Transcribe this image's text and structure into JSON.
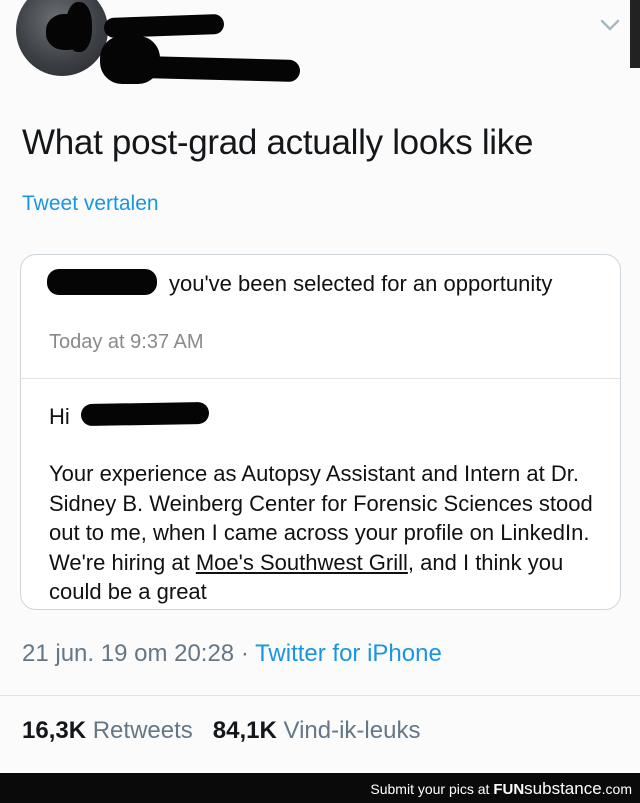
{
  "tweet": {
    "text": "What post-grad actually looks like",
    "translate_label": "Tweet vertalen",
    "timestamp": "21 jun. 19 om 20:28",
    "separator": "·",
    "source": "Twitter for iPhone",
    "retweets_count": "16,3K",
    "retweets_label": "Retweets",
    "likes_count": "84,1K",
    "likes_label": "Vind-ik-leuks"
  },
  "email": {
    "subject": "you've been selected for an opportunity",
    "time": "Today at 9:37 AM",
    "greeting": "Hi",
    "body_1": "Your experience as Autopsy Assistant and Intern at Dr. Sidney B. Weinberg Center for Forensic Sciences stood out to me, when I came across your profile on LinkedIn. We're hiring at ",
    "body_link": "Moe's Southwest Grill",
    "body_2": ", and I think you could be a great"
  },
  "footer": {
    "text": "Submit your pics at ",
    "brand_fun": "FUN",
    "brand_substance": "substance",
    "brand_com": ".com"
  },
  "icons": {
    "menu": "chevron-down-icon"
  },
  "colors": {
    "link": "#1b95e0",
    "muted": "#657786",
    "text": "#14171a",
    "redaction": "#050505"
  }
}
